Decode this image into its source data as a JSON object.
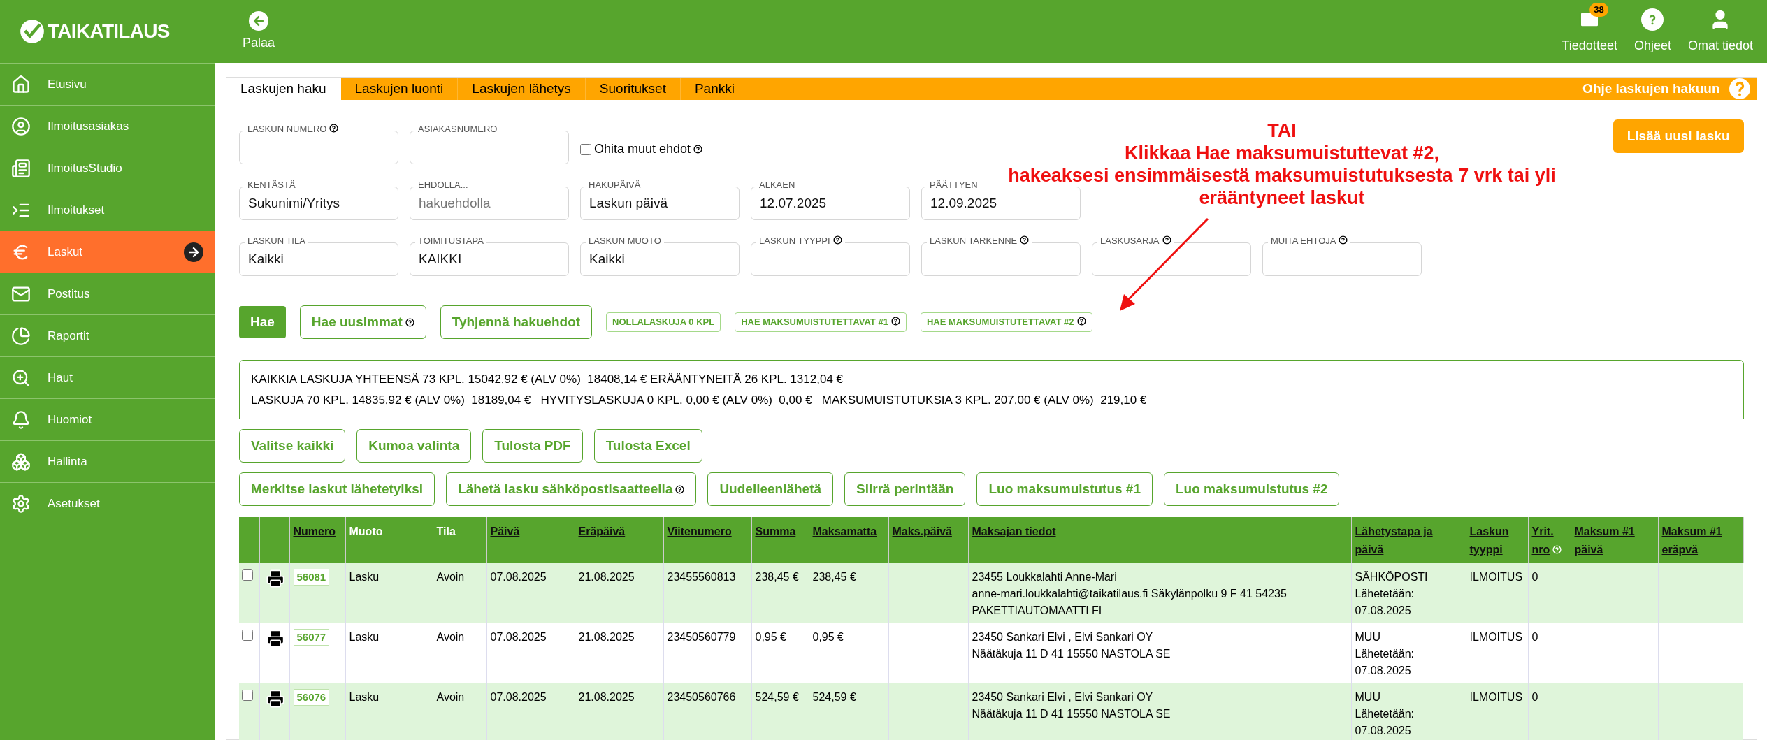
{
  "header": {
    "logo": "TAIKATILAUS",
    "back_label": "Palaa",
    "nav": [
      {
        "kind": "mail",
        "label": "Tiedotteet",
        "badge": "38"
      },
      {
        "kind": "help",
        "label": "Ohjeet"
      },
      {
        "kind": "user",
        "label": "Omat tiedot"
      }
    ]
  },
  "sidebar": {
    "items": [
      {
        "kind": "home",
        "label": "Etusivu",
        "selected": false
      },
      {
        "kind": "customer",
        "label": "Ilmoitusasiakas",
        "selected": false
      },
      {
        "kind": "studio",
        "label": "IlmoitusStudio",
        "selected": false
      },
      {
        "kind": "list",
        "label": "Ilmoitukset",
        "selected": false
      },
      {
        "kind": "euro",
        "label": "Laskut",
        "selected": true
      },
      {
        "kind": "mail",
        "label": "Postitus",
        "selected": false
      },
      {
        "kind": "chart",
        "label": "Raportit",
        "selected": false
      },
      {
        "kind": "search",
        "label": "Haut",
        "selected": false
      },
      {
        "kind": "bell",
        "label": "Huomiot",
        "selected": false
      },
      {
        "kind": "boxes",
        "label": "Hallinta",
        "selected": false
      },
      {
        "kind": "gear",
        "label": "Asetukset",
        "selected": false
      }
    ]
  },
  "tabs": [
    {
      "label": "Laskujen haku",
      "selected": true
    },
    {
      "label": "Laskujen luonti",
      "selected": false
    },
    {
      "label": "Laskujen lähetys",
      "selected": false
    },
    {
      "label": "Suoritukset",
      "selected": false
    },
    {
      "label": "Pankki",
      "selected": false
    }
  ],
  "help_link": "Ohje laskujen hakuun",
  "add_button": "Lisää uusi lasku",
  "form": {
    "rows": [
      [
        {
          "label": "LASKUN NUMERO",
          "help": true
        },
        {
          "label": "ASIAKASNUMERO",
          "help": false
        }
      ],
      [
        {
          "label": "KENTÄSTÄ",
          "value": "Sukunimi/Yritys",
          "help": false
        },
        {
          "label": "EHDOLLA...",
          "placeholder": "hakuehdolla",
          "help": false
        },
        {
          "label": "HAKUPÄIVÄ",
          "value": "Laskun päivä",
          "help": false
        },
        {
          "label": "ALKAEN",
          "value": "12.07.2025",
          "help": false
        },
        {
          "label": "PÄÄTTYEN",
          "value": "12.09.2025",
          "help": false
        }
      ],
      [
        {
          "label": "LASKUN TILA",
          "value": "Kaikki",
          "help": false
        },
        {
          "label": "TOIMITUSTAPA",
          "value": "KAIKKI",
          "help": false
        },
        {
          "label": "LASKUN MUOTO",
          "value": "Kaikki",
          "help": false
        },
        {
          "label": "LASKUN TYYPPI",
          "help": true
        },
        {
          "label": "LASKUN TARKENNE",
          "help": true
        },
        {
          "label": "LASKUSARJA",
          "help": true
        },
        {
          "label": "MUITA EHTOJA",
          "help": true
        }
      ]
    ],
    "skip_checkbox": {
      "label": "Ohita muut ehdot",
      "checked": false,
      "help": true
    }
  },
  "search_buttons": [
    {
      "kind": "primary",
      "label": "Hae",
      "help": false
    },
    {
      "kind": "outline",
      "label": "Hae uusimmat",
      "help": true
    },
    {
      "kind": "outline",
      "label": "Tyhjennä hakuehdot",
      "help": false
    },
    {
      "kind": "chip",
      "label": "NOLLALASKUJA 0 KPL",
      "help": false
    },
    {
      "kind": "chip",
      "label": "HAE MAKSUMUISTUTETTAVAT #1",
      "help": true
    },
    {
      "kind": "chip",
      "label": "HAE MAKSUMUISTUTETTAVAT #2",
      "help": true
    }
  ],
  "annotation": {
    "lines": [
      "TAI",
      "Klikkaa Hae maksumuistuttevat #2,",
      "hakeaksesi ensimmäisestä maksumuistutuksesta 7 vrk tai yli",
      "erääntyneet laskut"
    ]
  },
  "summary": [
    "KAIKKIA LASKUJA YHTEENSÄ 73 KPL. 15042,92 € (ALV 0%)  18408,14 € ERÄÄNTYNEITÄ 26 KPL. 1312,04 €",
    "LASKUJA 70 KPL. 14835,92 € (ALV 0%)  18189,04 €   HYVITYSLASKUJA 0 KPL. 0,00 € (ALV 0%)  0,00 €   MAKSUMUISTUTUKSIA 3 KPL. 207,00 € (ALV 0%)  219,10 €"
  ],
  "action_rows": [
    [
      {
        "label": "Valitse kaikki",
        "help": false
      },
      {
        "label": "Kumoa valinta",
        "help": false
      },
      {
        "label": "Tulosta PDF",
        "help": false
      },
      {
        "label": "Tulosta Excel",
        "help": false
      }
    ],
    [
      {
        "label": "Merkitse laskut lähetetyiksi",
        "help": false
      },
      {
        "label": "Lähetä lasku sähköpostisaatteella",
        "help": true
      },
      {
        "label": "Uudelleenlähetä",
        "help": false
      },
      {
        "label": "Siirrä perintään",
        "help": false
      },
      {
        "label": "Luo maksumuistutus #1",
        "help": false
      },
      {
        "label": "Luo maksumuistutus #2",
        "help": false
      }
    ]
  ],
  "table": {
    "columns": [
      {
        "label": "Numero",
        "sortable": true,
        "help": false
      },
      {
        "label": "Muoto",
        "sortable": false,
        "help": false
      },
      {
        "label": "Tila",
        "sortable": false,
        "help": false
      },
      {
        "label": "Päivä",
        "sortable": true,
        "help": false
      },
      {
        "label": "Eräpäivä",
        "sortable": true,
        "help": false
      },
      {
        "label": "Viitenumero",
        "sortable": true,
        "help": false
      },
      {
        "label": "Summa",
        "sortable": true,
        "help": false
      },
      {
        "label": "Maksamatta",
        "sortable": true,
        "help": false
      },
      {
        "label": "Maks.päivä",
        "sortable": true,
        "help": false
      },
      {
        "label": "Maksajan tiedot",
        "sortable": true,
        "help": false
      },
      {
        "label": "Lähetystapa ja päivä",
        "sortable": true,
        "help": false
      },
      {
        "label": "Laskun tyyppi",
        "sortable": true,
        "help": false
      },
      {
        "label": "Yrit. nro",
        "sortable": true,
        "help": true
      },
      {
        "label": "Maksum #1 päivä",
        "sortable": true,
        "help": false
      },
      {
        "label": "Maksum #1 eräpvä",
        "sortable": true,
        "help": false
      }
    ],
    "rows": [
      {
        "checked": false,
        "numero": "56081",
        "muoto": "Lasku",
        "tila": "Avoin",
        "paiva": "07.08.2025",
        "erapaiva": "21.08.2025",
        "viite": "23455560813",
        "summa": "238,45 €",
        "maksamatta": "238,45 €",
        "maksaja": [
          "23455 Loukkalahti Anne-Mari",
          "anne-mari.loukkalahti@taikatilaus.fi Säkylänpolku 9 F 41 54235",
          "PAKETTIAUTOMAATTI FI"
        ],
        "lahetys": [
          "SÄHKÖPOSTI",
          "Lähetetään:",
          "07.08.2025"
        ],
        "tyyppi": "ILMOITUS",
        "yrit": "0"
      },
      {
        "checked": false,
        "numero": "56077",
        "muoto": "Lasku",
        "tila": "Avoin",
        "paiva": "07.08.2025",
        "erapaiva": "21.08.2025",
        "viite": "23450560779",
        "summa": "0,95 €",
        "maksamatta": "0,95 €",
        "maksaja": [
          "23450 Sankari Elvi , Elvi Sankari OY",
          "Näätäkuja 11 D 41 15550 NASTOLA SE"
        ],
        "lahetys": [
          "MUU",
          "Lähetetään:",
          "07.08.2025"
        ],
        "tyyppi": "ILMOITUS",
        "yrit": "0"
      },
      {
        "checked": false,
        "numero": "56076",
        "muoto": "Lasku",
        "tila": "Avoin",
        "paiva": "07.08.2025",
        "erapaiva": "21.08.2025",
        "viite": "23450560766",
        "summa": "524,59 €",
        "maksamatta": "524,59 €",
        "maksaja": [
          "23450 Sankari Elvi , Elvi Sankari OY",
          "Näätäkuja 11 D 41 15550 NASTOLA SE"
        ],
        "lahetys": [
          "MUU",
          "Lähetetään:",
          "07.08.2025"
        ],
        "tyyppi": "ILMOITUS",
        "yrit": "0"
      }
    ]
  }
}
